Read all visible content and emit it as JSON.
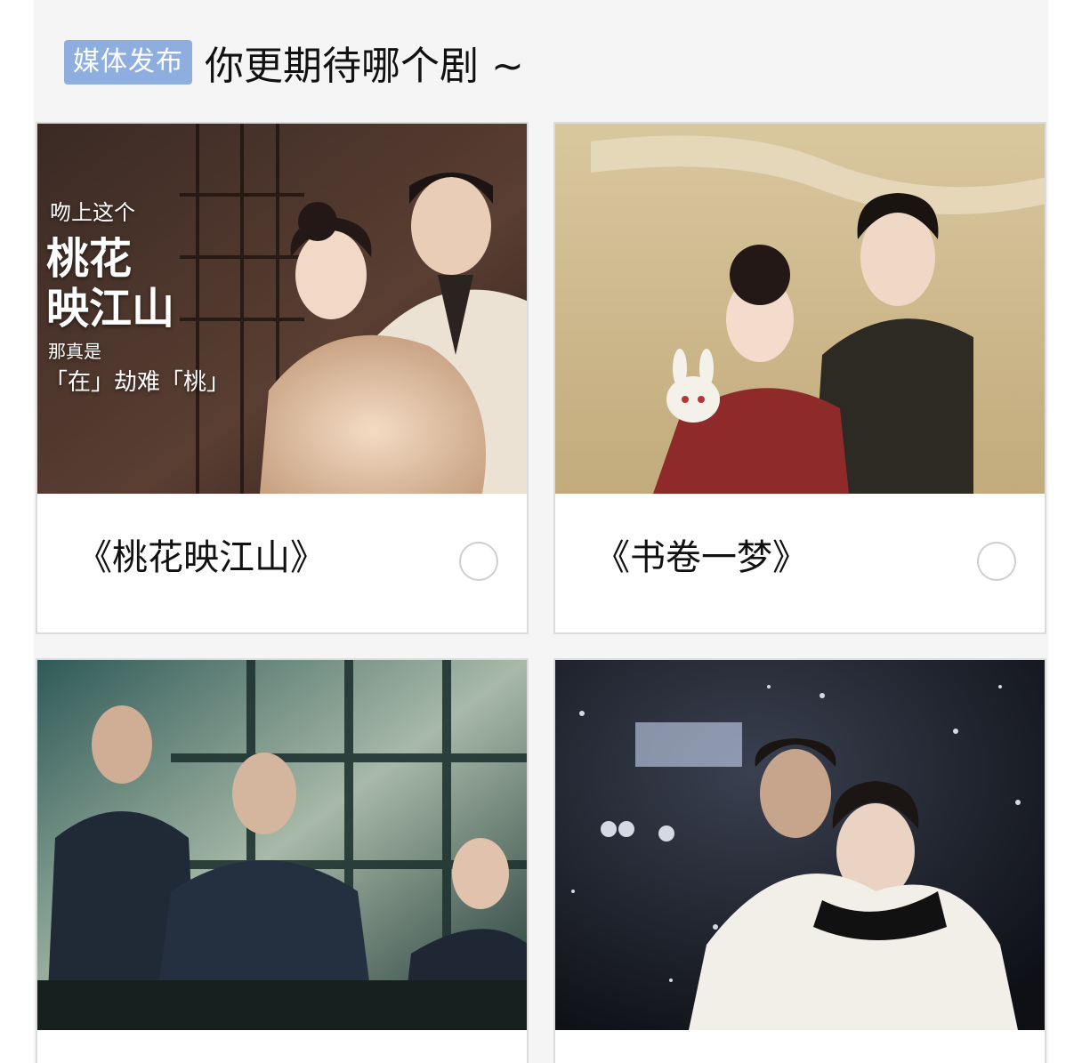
{
  "header": {
    "badge": "媒体发布",
    "title": "你更期待哪个剧 ~"
  },
  "options": [
    {
      "title": "《桃花映江山》",
      "poster_lines": [
        "吻上这个",
        "桃花",
        "映江山",
        "那真是",
        "「在」劫难「桃」"
      ],
      "image": "ancient-couple-poster"
    },
    {
      "title": "《书卷一梦》",
      "image": "ancient-couple-rabbit-mask-poster"
    },
    {
      "title": "",
      "image": "courtroom-drama-poster"
    },
    {
      "title": "",
      "image": "snow-piggyback-poster"
    }
  ],
  "colors": {
    "badge_bg": "#8eaee0",
    "panel_bg": "#f5f5f5",
    "radio_border": "#cfcfcf"
  }
}
